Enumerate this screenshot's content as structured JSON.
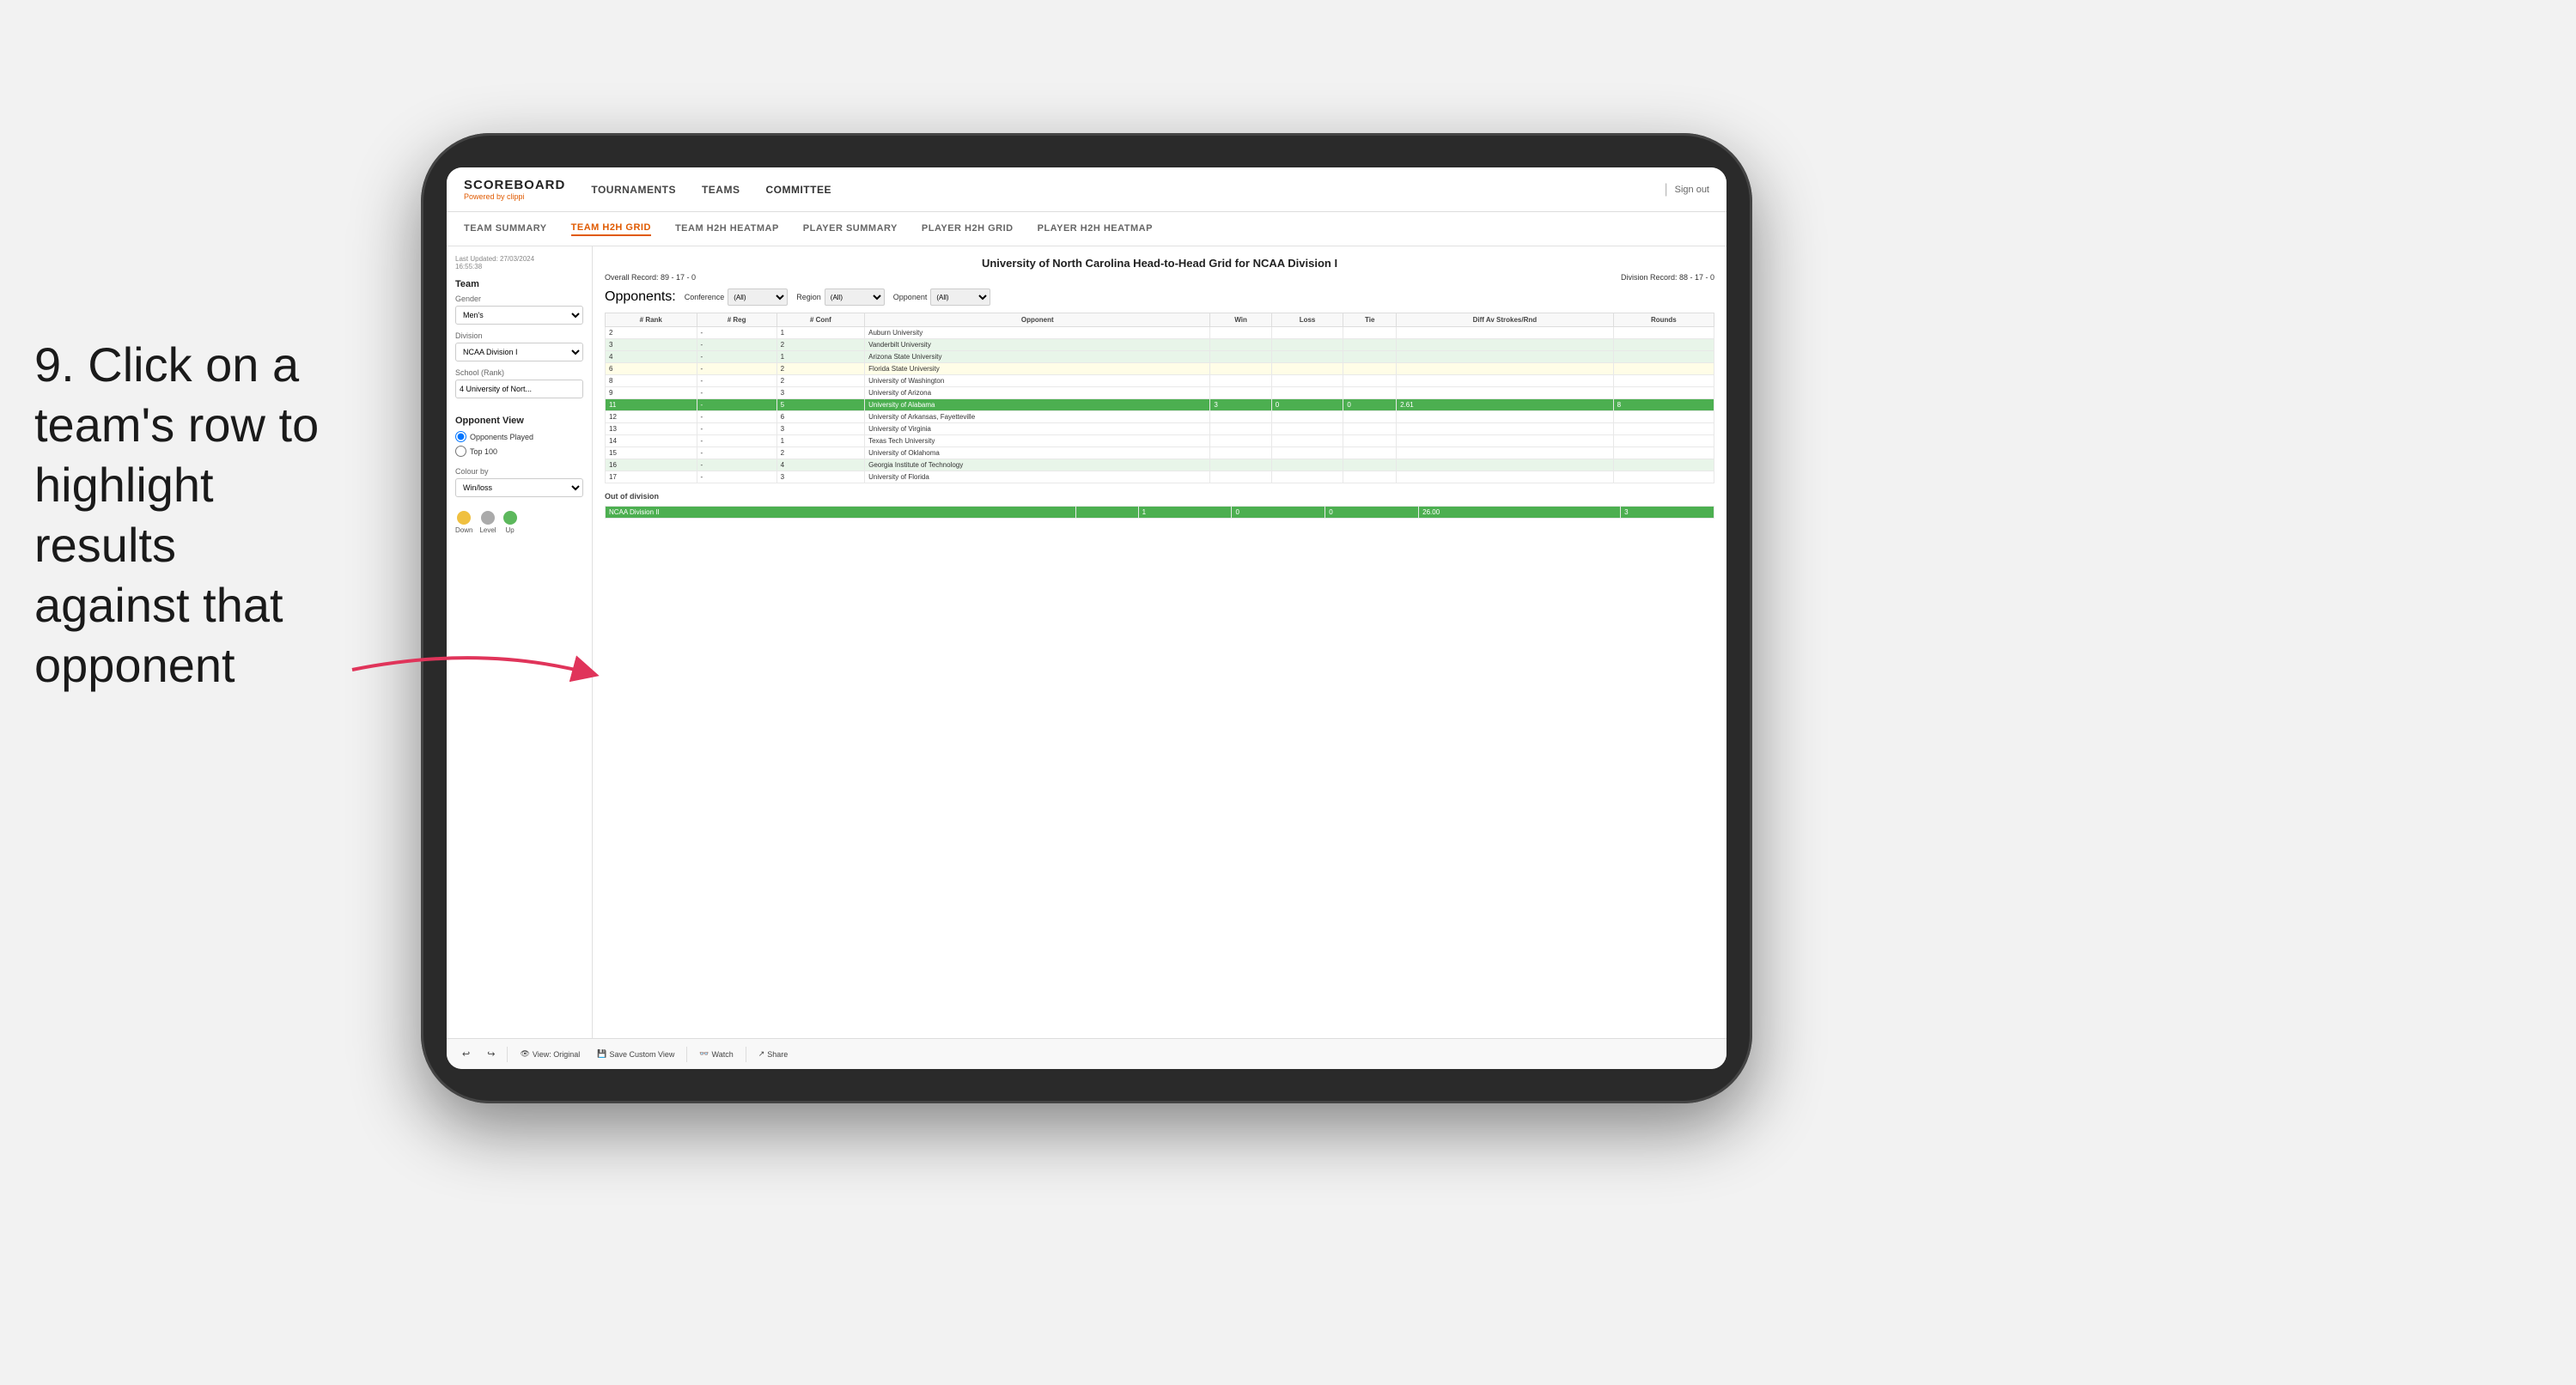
{
  "instruction": {
    "step": "9. Click on a team's row to highlight results against that opponent"
  },
  "nav": {
    "logo_main": "SCOREBOARD",
    "logo_sub_text": "Powered by ",
    "logo_brand": "clippi",
    "links": [
      "TOURNAMENTS",
      "TEAMS",
      "COMMITTEE"
    ],
    "sign_out": "Sign out"
  },
  "sub_nav": {
    "items": [
      "TEAM SUMMARY",
      "TEAM H2H GRID",
      "TEAM H2H HEATMAP",
      "PLAYER SUMMARY",
      "PLAYER H2H GRID",
      "PLAYER H2H HEATMAP"
    ],
    "active": "TEAM H2H GRID"
  },
  "left_panel": {
    "timestamp_label": "Last Updated: 27/03/2024",
    "timestamp_time": "16:55:38",
    "team_label": "Team",
    "gender_label": "Gender",
    "gender_value": "Men's",
    "division_label": "Division",
    "division_value": "NCAA Division I",
    "school_label": "School (Rank)",
    "school_value": "4 University of Nort...",
    "opponent_view_label": "Opponent View",
    "opponents_played_label": "Opponents Played",
    "top100_label": "Top 100",
    "colour_by_label": "Colour by",
    "colour_by_value": "Win/loss",
    "legend": [
      {
        "color": "#f0c040",
        "label": "Down"
      },
      {
        "color": "#aaaaaa",
        "label": "Level"
      },
      {
        "color": "#5cb85c",
        "label": "Up"
      }
    ]
  },
  "grid": {
    "title": "University of North Carolina Head-to-Head Grid for NCAA Division I",
    "overall_record": "Overall Record: 89 - 17 - 0",
    "division_record": "Division Record: 88 - 17 - 0",
    "filters": {
      "conference_label": "Conference",
      "conference_value": "(All)",
      "region_label": "Region",
      "region_value": "(All)",
      "opponent_label": "Opponent",
      "opponent_value": "(All)",
      "opponents_label": "Opponents:"
    },
    "columns": [
      "# Rank",
      "# Reg",
      "# Conf",
      "Opponent",
      "Win",
      "Loss",
      "Tie",
      "Diff Av Strokes/Rnd",
      "Rounds"
    ],
    "rows": [
      {
        "rank": "2",
        "reg": "-",
        "conf": "1",
        "opponent": "Auburn University",
        "win": "",
        "loss": "",
        "tie": "",
        "diff": "",
        "rounds": "",
        "style": "plain"
      },
      {
        "rank": "3",
        "reg": "-",
        "conf": "2",
        "opponent": "Vanderbilt University",
        "win": "",
        "loss": "",
        "tie": "",
        "diff": "",
        "rounds": "",
        "style": "light-green"
      },
      {
        "rank": "4",
        "reg": "-",
        "conf": "1",
        "opponent": "Arizona State University",
        "win": "",
        "loss": "",
        "tie": "",
        "diff": "",
        "rounds": "",
        "style": "light-green"
      },
      {
        "rank": "6",
        "reg": "-",
        "conf": "2",
        "opponent": "Florida State University",
        "win": "",
        "loss": "",
        "tie": "",
        "diff": "",
        "rounds": "",
        "style": "light-yellow"
      },
      {
        "rank": "8",
        "reg": "-",
        "conf": "2",
        "opponent": "University of Washington",
        "win": "",
        "loss": "",
        "tie": "",
        "diff": "",
        "rounds": "",
        "style": "plain"
      },
      {
        "rank": "9",
        "reg": "-",
        "conf": "3",
        "opponent": "University of Arizona",
        "win": "",
        "loss": "",
        "tie": "",
        "diff": "",
        "rounds": "",
        "style": "plain"
      },
      {
        "rank": "11",
        "reg": "-",
        "conf": "5",
        "opponent": "University of Alabama",
        "win": "3",
        "loss": "0",
        "tie": "0",
        "diff": "2.61",
        "rounds": "8",
        "style": "highlighted"
      },
      {
        "rank": "12",
        "reg": "-",
        "conf": "6",
        "opponent": "University of Arkansas, Fayetteville",
        "win": "",
        "loss": "",
        "tie": "",
        "diff": "",
        "rounds": "",
        "style": "plain"
      },
      {
        "rank": "13",
        "reg": "-",
        "conf": "3",
        "opponent": "University of Virginia",
        "win": "",
        "loss": "",
        "tie": "",
        "diff": "",
        "rounds": "",
        "style": "plain"
      },
      {
        "rank": "14",
        "reg": "-",
        "conf": "1",
        "opponent": "Texas Tech University",
        "win": "",
        "loss": "",
        "tie": "",
        "diff": "",
        "rounds": "",
        "style": "plain"
      },
      {
        "rank": "15",
        "reg": "-",
        "conf": "2",
        "opponent": "University of Oklahoma",
        "win": "",
        "loss": "",
        "tie": "",
        "diff": "",
        "rounds": "",
        "style": "plain"
      },
      {
        "rank": "16",
        "reg": "-",
        "conf": "4",
        "opponent": "Georgia Institute of Technology",
        "win": "",
        "loss": "",
        "tie": "",
        "diff": "",
        "rounds": "",
        "style": "light-green"
      },
      {
        "rank": "17",
        "reg": "-",
        "conf": "3",
        "opponent": "University of Florida",
        "win": "",
        "loss": "",
        "tie": "",
        "diff": "",
        "rounds": "",
        "style": "plain"
      }
    ],
    "out_of_division_label": "Out of division",
    "out_of_division_row": {
      "division": "NCAA Division II",
      "win": "1",
      "loss": "0",
      "tie": "0",
      "diff": "26.00",
      "rounds": "3",
      "style": "highlighted"
    }
  },
  "toolbar": {
    "undo": "↩",
    "redo": "↪",
    "view_original": "View: Original",
    "save_custom": "Save Custom View",
    "watch": "Watch",
    "share": "Share"
  }
}
